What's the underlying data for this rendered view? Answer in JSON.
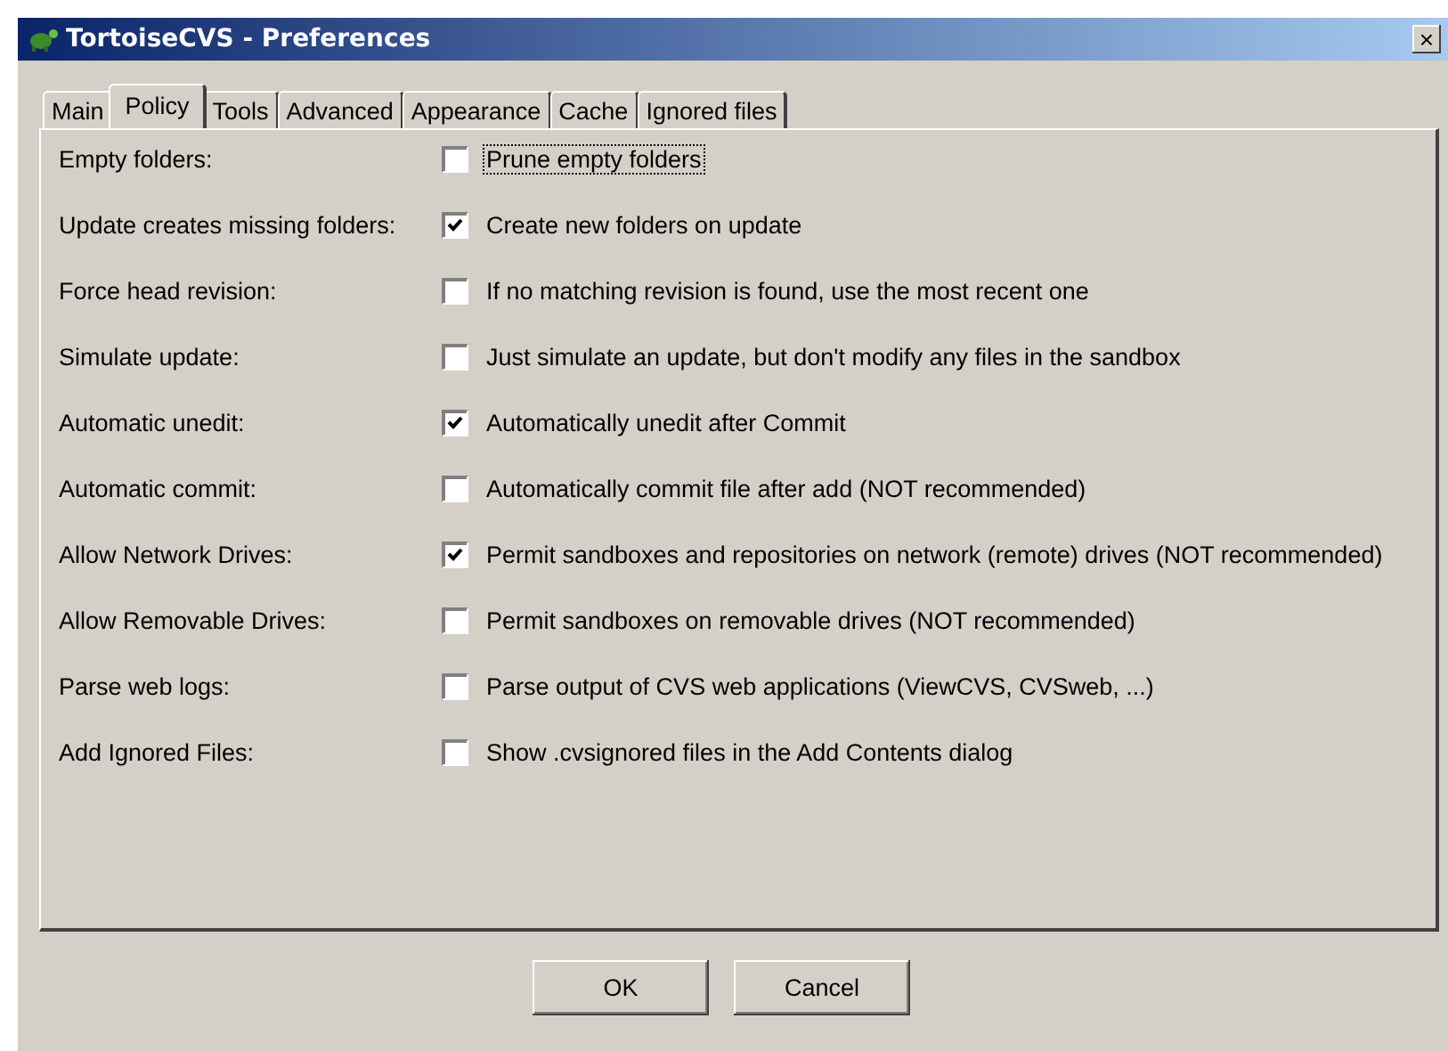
{
  "window": {
    "title": "TortoiseCVS - Preferences",
    "close": "×"
  },
  "tabs": [
    {
      "label": "Main",
      "selected": false
    },
    {
      "label": "Policy",
      "selected": true
    },
    {
      "label": "Tools",
      "selected": false
    },
    {
      "label": "Advanced",
      "selected": false
    },
    {
      "label": "Appearance",
      "selected": false
    },
    {
      "label": "Cache",
      "selected": false
    },
    {
      "label": "Ignored files",
      "selected": false
    }
  ],
  "settings": [
    {
      "label": "Empty folders:",
      "option": "Prune empty folders",
      "checked": false,
      "focused": true
    },
    {
      "label": "Update creates missing folders:",
      "option": "Create new folders on update",
      "checked": true,
      "focused": false
    },
    {
      "label": "Force head revision:",
      "option": "If no matching revision is found, use the most recent one",
      "checked": false,
      "focused": false
    },
    {
      "label": "Simulate update:",
      "option": "Just simulate an update, but don't modify any files in the sandbox",
      "checked": false,
      "focused": false
    },
    {
      "label": "Automatic unedit:",
      "option": "Automatically unedit after Commit",
      "checked": true,
      "focused": false
    },
    {
      "label": "Automatic commit:",
      "option": "Automatically commit file after add (NOT recommended)",
      "checked": false,
      "focused": false
    },
    {
      "label": "Allow Network Drives:",
      "option": "Permit sandboxes and repositories on network (remote) drives (NOT recommended)",
      "checked": true,
      "focused": false
    },
    {
      "label": "Allow Removable Drives:",
      "option": "Permit sandboxes on removable drives (NOT recommended)",
      "checked": false,
      "focused": false
    },
    {
      "label": "Parse web logs:",
      "option": "Parse output of CVS web applications (ViewCVS, CVSweb, ...)",
      "checked": false,
      "focused": false
    },
    {
      "label": "Add Ignored Files:",
      "option": "Show .cvsignored files in the Add Contents dialog",
      "checked": false,
      "focused": false
    }
  ],
  "buttons": [
    "OK",
    "Cancel"
  ]
}
